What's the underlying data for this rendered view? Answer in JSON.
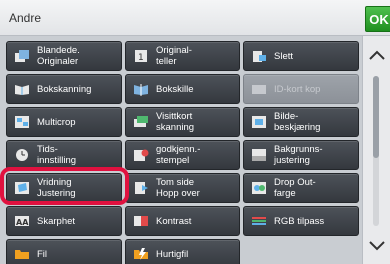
{
  "header": {
    "title": "Andre",
    "ok_label": "OK"
  },
  "buttons": [
    {
      "label": "Blandede.\nOriginaler",
      "icon": "mixed-originals-icon"
    },
    {
      "label": "Original-\nteller",
      "icon": "original-counter-icon"
    },
    {
      "label": "Slett",
      "icon": "erase-icon"
    },
    {
      "label": "Bokskanning",
      "icon": "book-scan-icon"
    },
    {
      "label": "Bokskille",
      "icon": "book-divide-icon"
    },
    {
      "label": "ID-kort kop",
      "icon": "id-card-icon",
      "disabled": true
    },
    {
      "label": "Multicrop",
      "icon": "multicrop-icon"
    },
    {
      "label": "Visittkort\nskanning",
      "icon": "business-card-icon"
    },
    {
      "label": "Bilde-\nbeskjæring",
      "icon": "image-crop-icon"
    },
    {
      "label": "Tids-\ninnstilling",
      "icon": "timer-icon"
    },
    {
      "label": "godkjenn.-\nstempel",
      "icon": "stamp-icon"
    },
    {
      "label": "Bakgrunns-\njustering",
      "icon": "background-adjust-icon"
    },
    {
      "label": "Vridning\nJustering",
      "icon": "skew-adjust-icon"
    },
    {
      "label": "Tom side\nHopp over",
      "icon": "blank-page-skip-icon"
    },
    {
      "label": "Drop Out-\nfarge",
      "icon": "drop-out-color-icon"
    },
    {
      "label": "Skarphet",
      "icon": "sharpness-icon"
    },
    {
      "label": "Kontrast",
      "icon": "contrast-icon"
    },
    {
      "label": "RGB tilpass",
      "icon": "rgb-adjust-icon"
    },
    {
      "label": "Fil",
      "icon": "folder-icon"
    },
    {
      "label": "Hurtigfil",
      "icon": "quick-file-icon"
    }
  ],
  "colors": {
    "highlight": "#e0113f",
    "ok": "#2aa52a",
    "button": "#3f444a"
  }
}
